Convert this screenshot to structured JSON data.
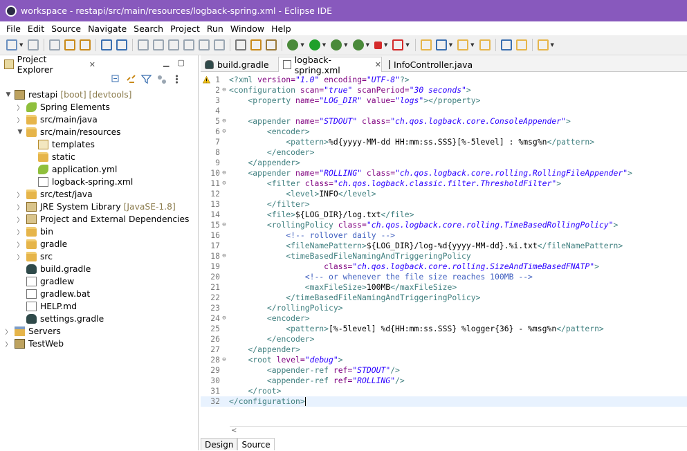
{
  "window": {
    "title": "workspace - restapi/src/main/resources/logback-spring.xml - Eclipse IDE"
  },
  "menubar": [
    "File",
    "Edit",
    "Source",
    "Navigate",
    "Search",
    "Project",
    "Run",
    "Window",
    "Help"
  ],
  "toolbar": {
    "icons": [
      "new-icon",
      "save-icon",
      "save-all-icon",
      "build-icon",
      "open-type-icon",
      "console-icon",
      "pin-icon",
      "resume-icon",
      "suspend-icon",
      "terminate-icon",
      "step-into-icon",
      "step-over-icon",
      "step-return-icon",
      "filter-icon",
      "wizard-icon",
      "marker-icon",
      "debug-icon",
      "run-icon",
      "coverage-icon",
      "run-external-icon",
      "stop-icon",
      "external-tools-icon",
      "new-class-icon",
      "new-package-icon",
      "open-task-icon",
      "search-icon",
      "globe-icon",
      "java-perspective-icon",
      "next-annotation-icon"
    ],
    "colors": {
      "debug": "#4a8a3a",
      "run": "#1fa02a",
      "stop": "#d42a2a",
      "folder": "#e6b54a",
      "blue": "#3a6fb0"
    }
  },
  "explorer": {
    "title": "Project Explorer",
    "tree": [
      {
        "label": "restapi",
        "decoration": "[boot] [devtools]",
        "icon": "project-icon",
        "chevron": "down",
        "indent": 0
      },
      {
        "label": "Spring Elements",
        "icon": "spring-leaf-icon",
        "chevron": "right",
        "indent": 1
      },
      {
        "label": "src/main/java",
        "icon": "source-folder-icon",
        "chevron": "right",
        "indent": 1
      },
      {
        "label": "src/main/resources",
        "icon": "source-folder-icon",
        "chevron": "down",
        "indent": 1
      },
      {
        "label": "templates",
        "icon": "package-icon",
        "chevron": "",
        "indent": 2
      },
      {
        "label": "static",
        "icon": "folder-icon",
        "chevron": "",
        "indent": 2
      },
      {
        "label": "application.yml",
        "icon": "spring-leaf-icon",
        "chevron": "",
        "indent": 2
      },
      {
        "label": "logback-spring.xml",
        "icon": "xml-file-icon",
        "chevron": "",
        "indent": 2
      },
      {
        "label": "src/test/java",
        "icon": "source-folder-icon",
        "chevron": "right",
        "indent": 1
      },
      {
        "label": "JRE System Library",
        "decoration": "[JavaSE-1.8]",
        "icon": "library-icon",
        "chevron": "right",
        "indent": 1
      },
      {
        "label": "Project and External Dependencies",
        "icon": "library-icon",
        "chevron": "right",
        "indent": 1
      },
      {
        "label": "bin",
        "icon": "folder-icon",
        "chevron": "right",
        "indent": 1
      },
      {
        "label": "gradle",
        "icon": "folder-icon",
        "chevron": "right",
        "indent": 1
      },
      {
        "label": "src",
        "icon": "folder-icon",
        "chevron": "right",
        "indent": 1
      },
      {
        "label": "build.gradle",
        "icon": "gradle-icon",
        "chevron": "",
        "indent": 1
      },
      {
        "label": "gradlew",
        "icon": "text-file-icon",
        "chevron": "",
        "indent": 1
      },
      {
        "label": "gradlew.bat",
        "icon": "text-file-icon",
        "chevron": "",
        "indent": 1
      },
      {
        "label": "HELP.md",
        "icon": "word-file-icon",
        "chevron": "",
        "indent": 1
      },
      {
        "label": "settings.gradle",
        "icon": "gradle-icon",
        "chevron": "",
        "indent": 1
      },
      {
        "label": "Servers",
        "icon": "server-folder-icon",
        "chevron": "right",
        "indent": 0
      },
      {
        "label": "TestWeb",
        "icon": "project-icon",
        "chevron": "right",
        "indent": 0
      }
    ]
  },
  "editor": {
    "tabs": [
      {
        "label": "build.gradle",
        "icon": "gradle-icon",
        "active": false
      },
      {
        "label": "logback-spring.xml",
        "icon": "xml-file-icon",
        "active": true
      },
      {
        "label": "InfoController.java",
        "icon": "java-file-icon",
        "active": false
      }
    ],
    "lines": [
      {
        "n": "1",
        "fold": "",
        "segs": [
          [
            "tag",
            "<?xml "
          ],
          [
            "an",
            "version="
          ],
          [
            "av",
            "\"1.0\""
          ],
          [
            "tx",
            " "
          ],
          [
            "an",
            "encoding="
          ],
          [
            "av",
            "\"UTF-8\""
          ],
          [
            "tag",
            "?>"
          ]
        ]
      },
      {
        "n": "2",
        "fold": "⊖",
        "segs": [
          [
            "tag",
            "<configuration "
          ],
          [
            "an",
            "scan="
          ],
          [
            "av",
            "\"true\""
          ],
          [
            "tx",
            " "
          ],
          [
            "an",
            "scanPeriod="
          ],
          [
            "av",
            "\"30 seconds\""
          ],
          [
            "tag",
            ">"
          ]
        ]
      },
      {
        "n": "3",
        "fold": "",
        "segs": [
          [
            "tx",
            "    "
          ],
          [
            "tag",
            "<property "
          ],
          [
            "an",
            "name="
          ],
          [
            "av",
            "\"LOG_DIR\""
          ],
          [
            "tx",
            " "
          ],
          [
            "an",
            "value="
          ],
          [
            "av",
            "\"logs\""
          ],
          [
            "tag",
            "></property>"
          ]
        ]
      },
      {
        "n": "4",
        "fold": "",
        "segs": []
      },
      {
        "n": "5",
        "fold": "⊖",
        "segs": [
          [
            "tx",
            "    "
          ],
          [
            "tag",
            "<appender "
          ],
          [
            "an",
            "name="
          ],
          [
            "av",
            "\"STDOUT\""
          ],
          [
            "tx",
            " "
          ],
          [
            "an",
            "class="
          ],
          [
            "av",
            "\"ch.qos.logback.core.ConsoleAppender\""
          ],
          [
            "tag",
            ">"
          ]
        ]
      },
      {
        "n": "6",
        "fold": "⊖",
        "segs": [
          [
            "tx",
            "        "
          ],
          [
            "tag",
            "<encoder>"
          ]
        ]
      },
      {
        "n": "7",
        "fold": "",
        "segs": [
          [
            "tx",
            "            "
          ],
          [
            "tag",
            "<pattern>"
          ],
          [
            "tx",
            "%d{yyyy-MM-dd HH:mm:ss.SSS}[%-5level] : %msg%n"
          ],
          [
            "tag",
            "</pattern>"
          ]
        ]
      },
      {
        "n": "8",
        "fold": "",
        "segs": [
          [
            "tx",
            "        "
          ],
          [
            "tag",
            "</encoder>"
          ]
        ]
      },
      {
        "n": "9",
        "fold": "",
        "segs": [
          [
            "tx",
            "    "
          ],
          [
            "tag",
            "</appender>"
          ]
        ]
      },
      {
        "n": "10",
        "fold": "⊖",
        "segs": [
          [
            "tx",
            "    "
          ],
          [
            "tag",
            "<appender "
          ],
          [
            "an",
            "name="
          ],
          [
            "av",
            "\"ROLLING\""
          ],
          [
            "tx",
            " "
          ],
          [
            "an",
            "class="
          ],
          [
            "av",
            "\"ch.qos.logback.core.rolling.RollingFileAppender\""
          ],
          [
            "tag",
            ">"
          ]
        ]
      },
      {
        "n": "11",
        "fold": "⊖",
        "segs": [
          [
            "tx",
            "        "
          ],
          [
            "tag",
            "<filter "
          ],
          [
            "an",
            "class="
          ],
          [
            "av",
            "\"ch.qos.logback.classic.filter.ThresholdFilter\""
          ],
          [
            "tag",
            ">"
          ]
        ]
      },
      {
        "n": "12",
        "fold": "",
        "segs": [
          [
            "tx",
            "            "
          ],
          [
            "tag",
            "<level>"
          ],
          [
            "tx",
            "INFO"
          ],
          [
            "tag",
            "</level>"
          ]
        ]
      },
      {
        "n": "13",
        "fold": "",
        "segs": [
          [
            "tx",
            "        "
          ],
          [
            "tag",
            "</filter>"
          ]
        ]
      },
      {
        "n": "14",
        "fold": "",
        "segs": [
          [
            "tx",
            "        "
          ],
          [
            "tag",
            "<file>"
          ],
          [
            "tx",
            "${LOG_DIR}/log.txt"
          ],
          [
            "tag",
            "</file>"
          ]
        ]
      },
      {
        "n": "15",
        "fold": "⊖",
        "segs": [
          [
            "tx",
            "        "
          ],
          [
            "tag",
            "<rollingPolicy "
          ],
          [
            "an",
            "class="
          ],
          [
            "av",
            "\"ch.qos.logback.core.rolling.TimeBasedRollingPolicy\""
          ],
          [
            "tag",
            ">"
          ]
        ]
      },
      {
        "n": "16",
        "fold": "",
        "segs": [
          [
            "tx",
            "            "
          ],
          [
            "cm",
            "<!-- rollover daily -->"
          ]
        ]
      },
      {
        "n": "17",
        "fold": "",
        "segs": [
          [
            "tx",
            "            "
          ],
          [
            "tag",
            "<fileNamePattern>"
          ],
          [
            "tx",
            "${LOG_DIR}/log-%d{yyyy-MM-dd}.%i.txt"
          ],
          [
            "tag",
            "</fileNamePattern>"
          ]
        ]
      },
      {
        "n": "18",
        "fold": "⊖",
        "segs": [
          [
            "tx",
            "            "
          ],
          [
            "tag",
            "<timeBasedFileNamingAndTriggeringPolicy"
          ]
        ]
      },
      {
        "n": "19",
        "fold": "",
        "segs": [
          [
            "tx",
            "                    "
          ],
          [
            "an",
            "class="
          ],
          [
            "av",
            "\"ch.qos.logback.core.rolling.SizeAndTimeBasedFNATP\""
          ],
          [
            "tag",
            ">"
          ]
        ]
      },
      {
        "n": "20",
        "fold": "",
        "segs": [
          [
            "tx",
            "                "
          ],
          [
            "cm",
            "<!-- or whenever the file size reaches 100MB -->"
          ]
        ]
      },
      {
        "n": "21",
        "fold": "",
        "segs": [
          [
            "tx",
            "                "
          ],
          [
            "tag",
            "<maxFileSize>"
          ],
          [
            "tx",
            "100MB"
          ],
          [
            "tag",
            "</maxFileSize>"
          ]
        ]
      },
      {
        "n": "22",
        "fold": "",
        "segs": [
          [
            "tx",
            "            "
          ],
          [
            "tag",
            "</timeBasedFileNamingAndTriggeringPolicy>"
          ]
        ]
      },
      {
        "n": "23",
        "fold": "",
        "segs": [
          [
            "tx",
            "        "
          ],
          [
            "tag",
            "</rollingPolicy>"
          ]
        ]
      },
      {
        "n": "24",
        "fold": "⊖",
        "segs": [
          [
            "tx",
            "        "
          ],
          [
            "tag",
            "<encoder>"
          ]
        ]
      },
      {
        "n": "25",
        "fold": "",
        "segs": [
          [
            "tx",
            "            "
          ],
          [
            "tag",
            "<pattern>"
          ],
          [
            "tx",
            "[%-5level] %d{HH:mm:ss.SSS} %logger{36} - %msg%n"
          ],
          [
            "tag",
            "</pattern>"
          ]
        ]
      },
      {
        "n": "26",
        "fold": "",
        "segs": [
          [
            "tx",
            "        "
          ],
          [
            "tag",
            "</encoder>"
          ]
        ]
      },
      {
        "n": "27",
        "fold": "",
        "segs": [
          [
            "tx",
            "    "
          ],
          [
            "tag",
            "</appender>"
          ]
        ]
      },
      {
        "n": "28",
        "fold": "⊖",
        "segs": [
          [
            "tx",
            "    "
          ],
          [
            "tag",
            "<root "
          ],
          [
            "an",
            "level="
          ],
          [
            "av",
            "\"debug\""
          ],
          [
            "tag",
            ">"
          ]
        ]
      },
      {
        "n": "29",
        "fold": "",
        "segs": [
          [
            "tx",
            "        "
          ],
          [
            "tag",
            "<appender-ref "
          ],
          [
            "an",
            "ref="
          ],
          [
            "av",
            "\"STDOUT\""
          ],
          [
            "tag",
            "/>"
          ]
        ]
      },
      {
        "n": "30",
        "fold": "",
        "segs": [
          [
            "tx",
            "        "
          ],
          [
            "tag",
            "<appender-ref "
          ],
          [
            "an",
            "ref="
          ],
          [
            "av",
            "\"ROLLING\""
          ],
          [
            "tag",
            "/>"
          ]
        ]
      },
      {
        "n": "31",
        "fold": "",
        "segs": [
          [
            "tx",
            "    "
          ],
          [
            "tag",
            "</root>"
          ]
        ]
      },
      {
        "n": "32",
        "fold": "",
        "segs": [
          [
            "tag",
            "</configuration>"
          ]
        ],
        "current": true
      }
    ],
    "bottom_tabs": [
      {
        "label": "Design",
        "active": false
      },
      {
        "label": "Source",
        "active": true
      }
    ]
  }
}
